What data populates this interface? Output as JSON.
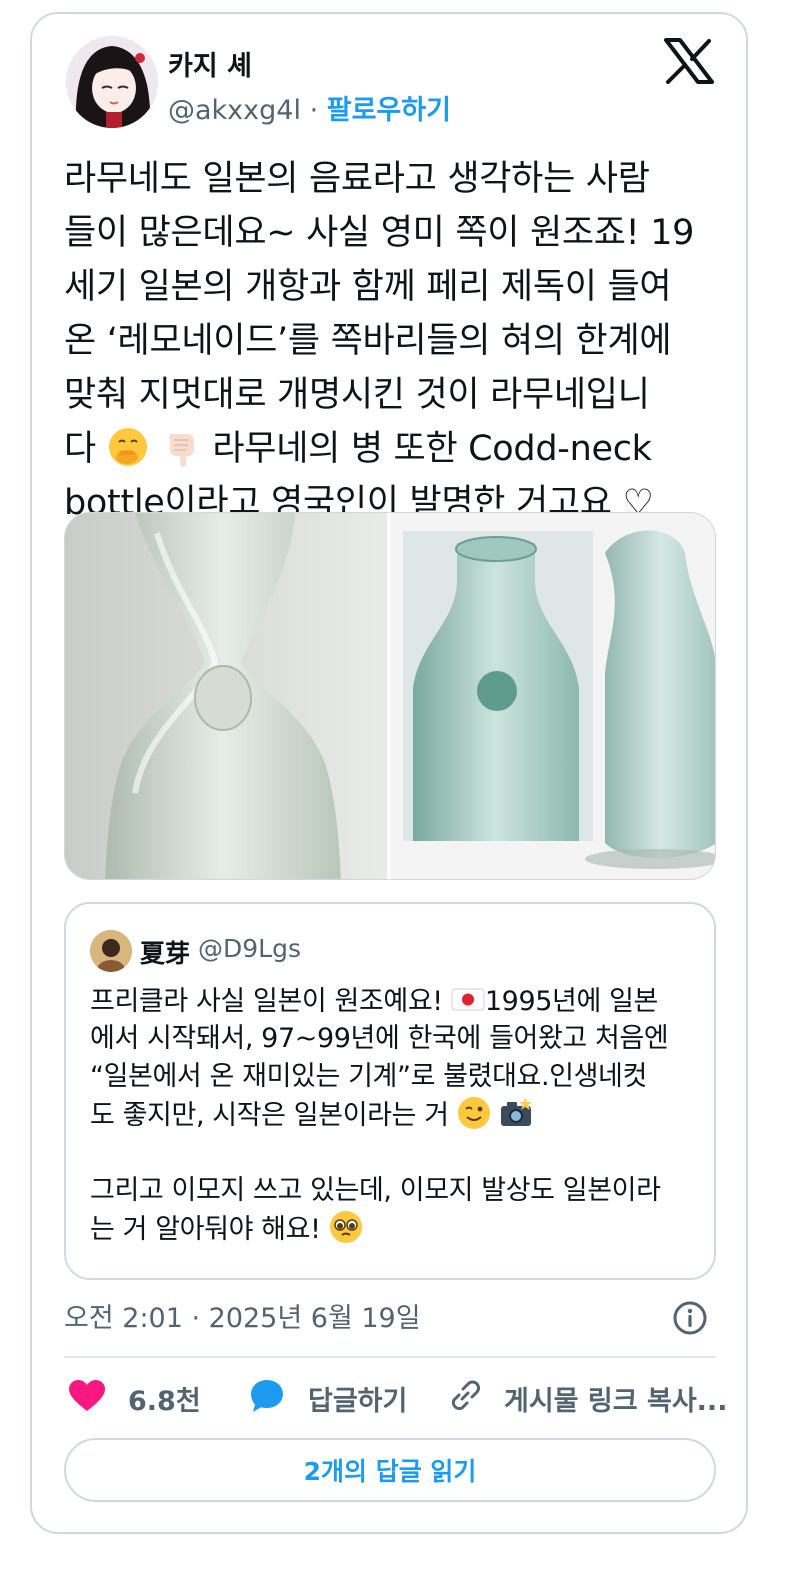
{
  "author": {
    "name": "카지 셰",
    "handle": "@akxxg4l",
    "separator": "·",
    "follow_label": "팔로우하기"
  },
  "tweet": {
    "lines": [
      "라무네도 일본의 음료라고 생각하는 사람",
      "들이 많은데요~ 사실 영미 쪽이 원조죠! 19",
      "세기 일본의 개항과 함께 페리 제독이 들여",
      "온 ‘레모네이드’를 쪽바리들의 혀의 한계에",
      "맞춰 지멋대로 개명시킨 것이 라무네입니",
      "다",
      "라무네의 병 또한  Codd-neck",
      "bottle이라고 영국인이 발명한 거고요 ♡"
    ],
    "emojis": [
      "hand-over-mouth-emoji",
      "backhand-index-pointing-down-emoji"
    ]
  },
  "media": {
    "images": [
      "codd-neck-bottle-closeup-image",
      "codd-neck-bottles-image"
    ]
  },
  "quote": {
    "name": "夏芽",
    "handle": "@D9Lgs",
    "lines": [
      "프리클라 사실 일본이 원조예요!",
      "1995년에 일본",
      "에서 시작돼서, 97~99년에 한국에 들어왔고 처음엔",
      "“일본에서 온 재미있는 기계”로 불렸대요.인생네컷",
      "도 좋지만, 시작은 일본이라는 거",
      "그리고 이모지 쓰고 있는데, 이모지 발상도 일본이라",
      "는 거 알아둬야 해요!"
    ],
    "emojis": [
      "japan-flag-emoji",
      "winking-face-emoji",
      "camera-with-flash-emoji",
      "pleading-face-emoji"
    ]
  },
  "timestamp": "오전 2:01 · 2025년 6월 19일",
  "actions": {
    "like_count": "6.8천",
    "reply_label": "답글하기",
    "copy_label": "게시물 링크 복사..."
  },
  "read_replies_label": "2개의 답글 읽기",
  "colors": {
    "accent": "#1d9bf0",
    "like": "#f91880",
    "text": "#0f1419",
    "secondary": "#536471",
    "border": "#cfd9de"
  }
}
